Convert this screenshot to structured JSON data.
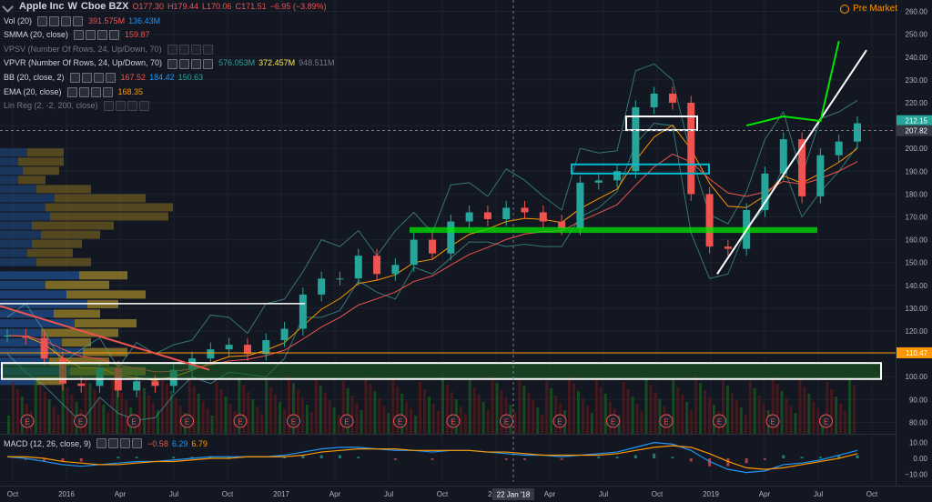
{
  "header": {
    "symbol": "Apple Inc",
    "interval": "W",
    "exchange": "Cboe BZX",
    "open": "O177.30",
    "high": "H179.44",
    "low": "L170.06",
    "close": "C171.51",
    "change": "−6.95 (−3.89%)",
    "premarket": "Pre Market"
  },
  "indicators": [
    {
      "label": "Vol (20)",
      "values": [
        "391.575M",
        "136.43M"
      ],
      "colors": [
        "#ef5350",
        "#2196f3"
      ],
      "dim": false
    },
    {
      "label": "SMMA (20, close)",
      "values": [
        "159.87"
      ],
      "colors": [
        "#ef5350"
      ],
      "dim": false
    },
    {
      "label": "VPSV (Number Of Rows, 24, Up/Down, 70)",
      "values": [],
      "colors": [],
      "dim": true
    },
    {
      "label": "VPVR (Number Of Rows, 24, Up/Down, 70)",
      "values": [
        "576.053M",
        "372.457M",
        "948.511M"
      ],
      "colors": [
        "#26a69a",
        "#ffeb3b",
        "#787b86"
      ],
      "dim": false
    },
    {
      "label": "BB (20, close, 2)",
      "values": [
        "167.52",
        "184.42",
        "150.63"
      ],
      "colors": [
        "#ef5350",
        "#2196f3",
        "#26a69a"
      ],
      "dim": false
    },
    {
      "label": "EMA (20, close)",
      "values": [
        "168.35"
      ],
      "colors": [
        "#ff9800"
      ],
      "dim": false
    },
    {
      "label": "Lin Reg (2, -2, 200, close)",
      "values": [],
      "colors": [],
      "dim": true
    }
  ],
  "macd": {
    "label": "MACD (12, 26, close, 9)",
    "values": [
      "−0.58",
      "6.29",
      "6.79"
    ],
    "colors": [
      "#ef5350",
      "#2196f3",
      "#ff9800"
    ]
  },
  "price_axis": {
    "ticks": [
      "260.00",
      "250.00",
      "240.00",
      "230.00",
      "220.00",
      "210.00",
      "200.00",
      "190.00",
      "180.00",
      "170.00",
      "160.00",
      "150.00",
      "140.00",
      "130.00",
      "120.00",
      "110.00",
      "100.00",
      "90.00",
      "80.00"
    ],
    "macd_ticks": [
      "10.00",
      "0.00",
      "−10.00"
    ],
    "tag_last": "212.15",
    "tag_cursor": "207.82",
    "tag_line": "110.47"
  },
  "time_axis": {
    "ticks": [
      "Oct",
      "2016",
      "Apr",
      "Jul",
      "Oct",
      "2017",
      "Apr",
      "Jul",
      "Oct",
      "2018",
      "Apr",
      "Jul",
      "Oct",
      "2019",
      "Apr",
      "Jul",
      "Oct"
    ],
    "cursor_date": "22 Jan '18"
  },
  "earnings_marker": "E",
  "colors": {
    "background": "#131722",
    "up": "#26a69a",
    "down": "#ef5350",
    "accent_green": "#00e600",
    "zone_green": "#1b5e20",
    "cyan": "#00bcd4"
  },
  "chart_data": {
    "type": "candlestick",
    "interval": "weekly",
    "x": [
      "2015-10",
      "2015-11",
      "2015-12",
      "2016-01",
      "2016-02",
      "2016-03",
      "2016-04",
      "2016-05",
      "2016-06",
      "2016-07",
      "2016-08",
      "2016-09",
      "2016-10",
      "2016-11",
      "2016-12",
      "2017-01",
      "2017-02",
      "2017-03",
      "2017-04",
      "2017-05",
      "2017-06",
      "2017-07",
      "2017-08",
      "2017-09",
      "2017-10",
      "2017-11",
      "2017-12",
      "2018-01",
      "2018-02",
      "2018-03",
      "2018-04",
      "2018-05",
      "2018-06",
      "2018-07",
      "2018-08",
      "2018-09",
      "2018-10",
      "2018-11",
      "2018-12",
      "2019-01",
      "2019-02",
      "2019-03",
      "2019-04",
      "2019-05",
      "2019-06",
      "2019-07",
      "2019-08"
    ],
    "close": [
      118,
      117,
      108,
      97,
      96,
      104,
      94,
      98,
      96,
      103,
      108,
      112,
      114,
      110,
      116,
      121,
      136,
      143,
      143,
      153,
      145,
      149,
      160,
      154,
      168,
      172,
      169,
      174,
      172,
      168,
      165,
      185,
      186,
      190,
      218,
      224,
      220,
      180,
      157,
      156,
      173,
      189,
      204,
      179,
      197,
      203,
      211
    ],
    "y_range": [
      75,
      265
    ],
    "last_close": 211,
    "earnings_count": 16,
    "support_line": 110.47,
    "last_price": 212.15,
    "cursor_price": 207.82,
    "macd": {
      "macd_line": [
        1,
        0,
        -2,
        -4,
        -5,
        -4,
        -3,
        -2,
        -2,
        -1,
        0,
        1,
        1,
        1,
        1,
        2,
        4,
        6,
        7,
        7,
        6,
        5,
        5,
        4,
        5,
        5,
        4,
        3,
        2,
        2,
        1,
        2,
        3,
        4,
        7,
        10,
        9,
        5,
        -2,
        -7,
        -9,
        -8,
        -4,
        -3,
        -1,
        2,
        5
      ],
      "signal_line": [
        1,
        1,
        0,
        -2,
        -3,
        -4,
        -4,
        -3,
        -2,
        -2,
        -1,
        0,
        0,
        1,
        1,
        1,
        2,
        4,
        5,
        6,
        6,
        6,
        5,
        5,
        5,
        5,
        4,
        4,
        3,
        2,
        2,
        2,
        2,
        3,
        5,
        7,
        8,
        7,
        3,
        -2,
        -6,
        -7,
        -6,
        -4,
        -2,
        0,
        3
      ],
      "y_range": [
        -15,
        15
      ]
    }
  }
}
